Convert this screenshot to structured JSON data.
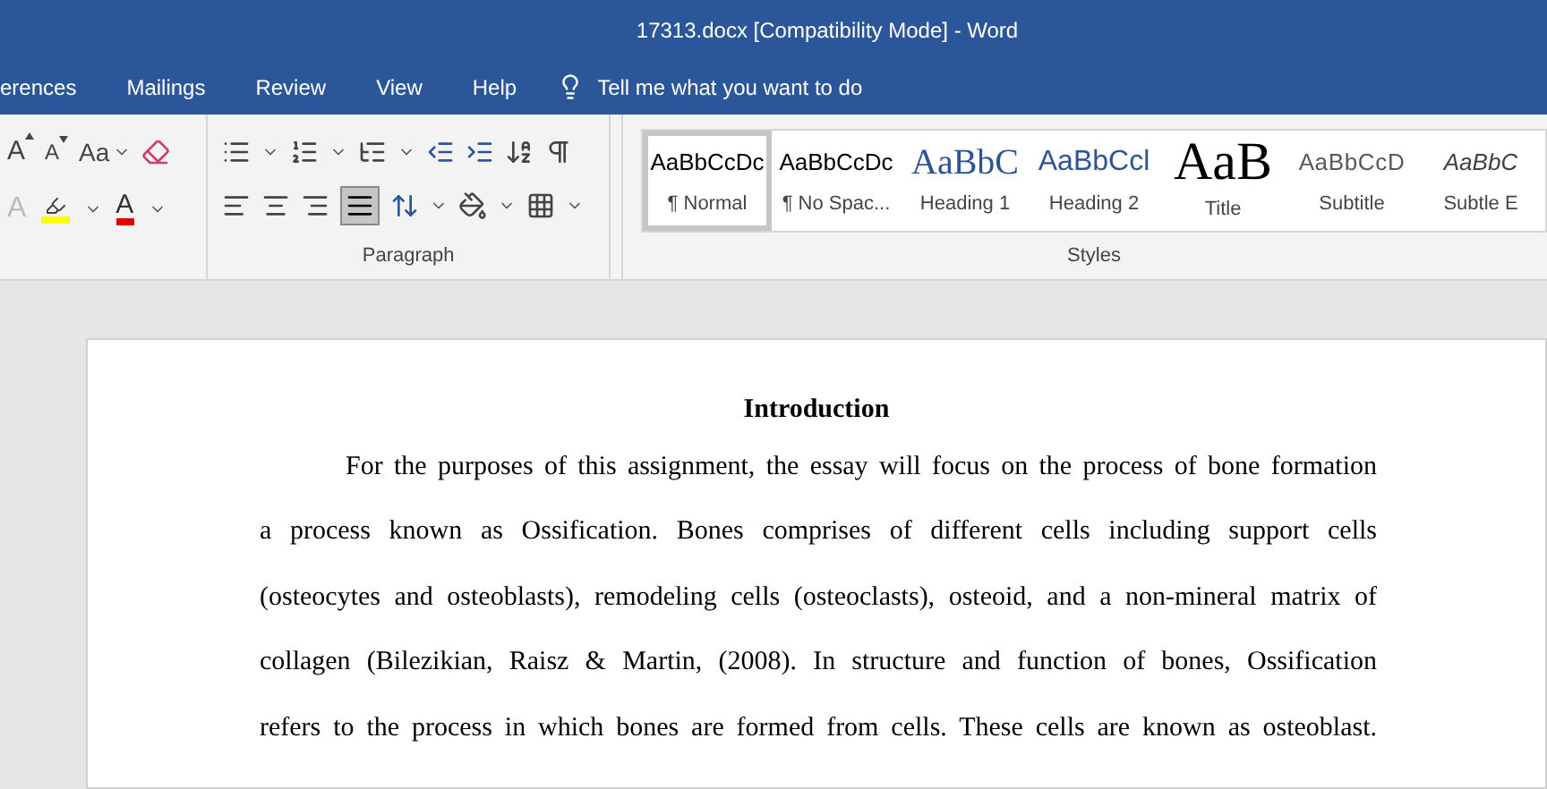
{
  "window": {
    "title": "17313.docx [Compatibility Mode]  -  Word"
  },
  "tabs": [
    {
      "label": "erences",
      "selected": false
    },
    {
      "label": "Mailings",
      "selected": false
    },
    {
      "label": "Review",
      "selected": false
    },
    {
      "label": "View",
      "selected": false
    },
    {
      "label": "Help",
      "selected": false
    }
  ],
  "tell_me": {
    "placeholder": "Tell me what you want to do"
  },
  "ribbon": {
    "font_group": {
      "grow_font": "A",
      "shrink_font": "A",
      "case_button": "Aa",
      "text_effects": "A",
      "font_color": "A"
    },
    "paragraph_group": {
      "label": "Paragraph",
      "justify_selected": true
    },
    "styles_group": {
      "label": "Styles",
      "styles": [
        {
          "preview": "AaBbCcDc",
          "name": "¶ Normal",
          "kind": "normal",
          "selected": true
        },
        {
          "preview": "AaBbCcDc",
          "name": "¶ No Spac...",
          "kind": "normal",
          "selected": false
        },
        {
          "preview": "AaBbC",
          "name": "Heading 1",
          "kind": "heading1",
          "selected": false
        },
        {
          "preview": "AaBbCcl",
          "name": "Heading 2",
          "kind": "heading2",
          "selected": false
        },
        {
          "preview": "AaB",
          "name": "Title",
          "kind": "title",
          "selected": false
        },
        {
          "preview": "AaBbCcD",
          "name": "Subtitle",
          "kind": "subtitle",
          "selected": false
        },
        {
          "preview": "AaBbC",
          "name": "Subtle E",
          "kind": "subtle",
          "selected": false
        }
      ]
    }
  },
  "document": {
    "heading": "Introduction",
    "lines": [
      "For the purposes of this assignment, the essay will focus on the process of bone formation",
      "a process known as Ossification. Bones comprises of different cells including support cells",
      "(osteocytes and osteoblasts), remodeling cells (osteoclasts), osteoid, and a non-mineral matrix of",
      "collagen (Bilezikian, Raisz & Martin, (2008). In structure and function of bones, Ossification",
      "refers to the process in which bones are formed from cells. These cells are known as osteoblast."
    ]
  }
}
